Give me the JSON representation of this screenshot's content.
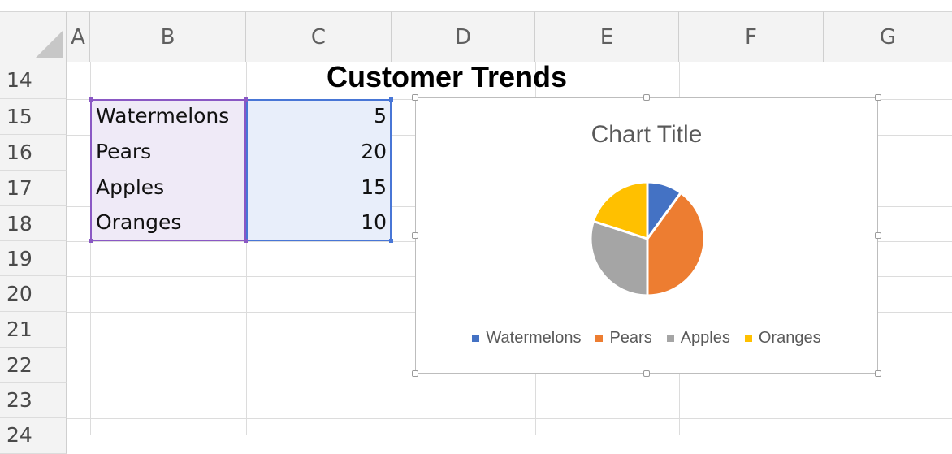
{
  "sheet": {
    "columns": [
      "A",
      "B",
      "C",
      "D",
      "E",
      "F",
      "G"
    ],
    "rows": [
      "14",
      "15",
      "16",
      "17",
      "18",
      "19",
      "20",
      "21",
      "22",
      "23",
      "24"
    ],
    "title": "Customer Trends",
    "cells": [
      {
        "label": "Watermelons",
        "value": "5"
      },
      {
        "label": "Pears",
        "value": "20"
      },
      {
        "label": "Apples",
        "value": "15"
      },
      {
        "label": "Oranges",
        "value": "10"
      }
    ]
  },
  "colors": {
    "Watermelons": "#4472c4",
    "Pears": "#ed7d31",
    "Apples": "#a5a5a5",
    "Oranges": "#ffc000"
  },
  "chart_data": {
    "type": "pie",
    "title": "Chart Title",
    "categories": [
      "Watermelons",
      "Pears",
      "Apples",
      "Oranges"
    ],
    "values": [
      5,
      20,
      15,
      10
    ],
    "legend": "bottom"
  }
}
